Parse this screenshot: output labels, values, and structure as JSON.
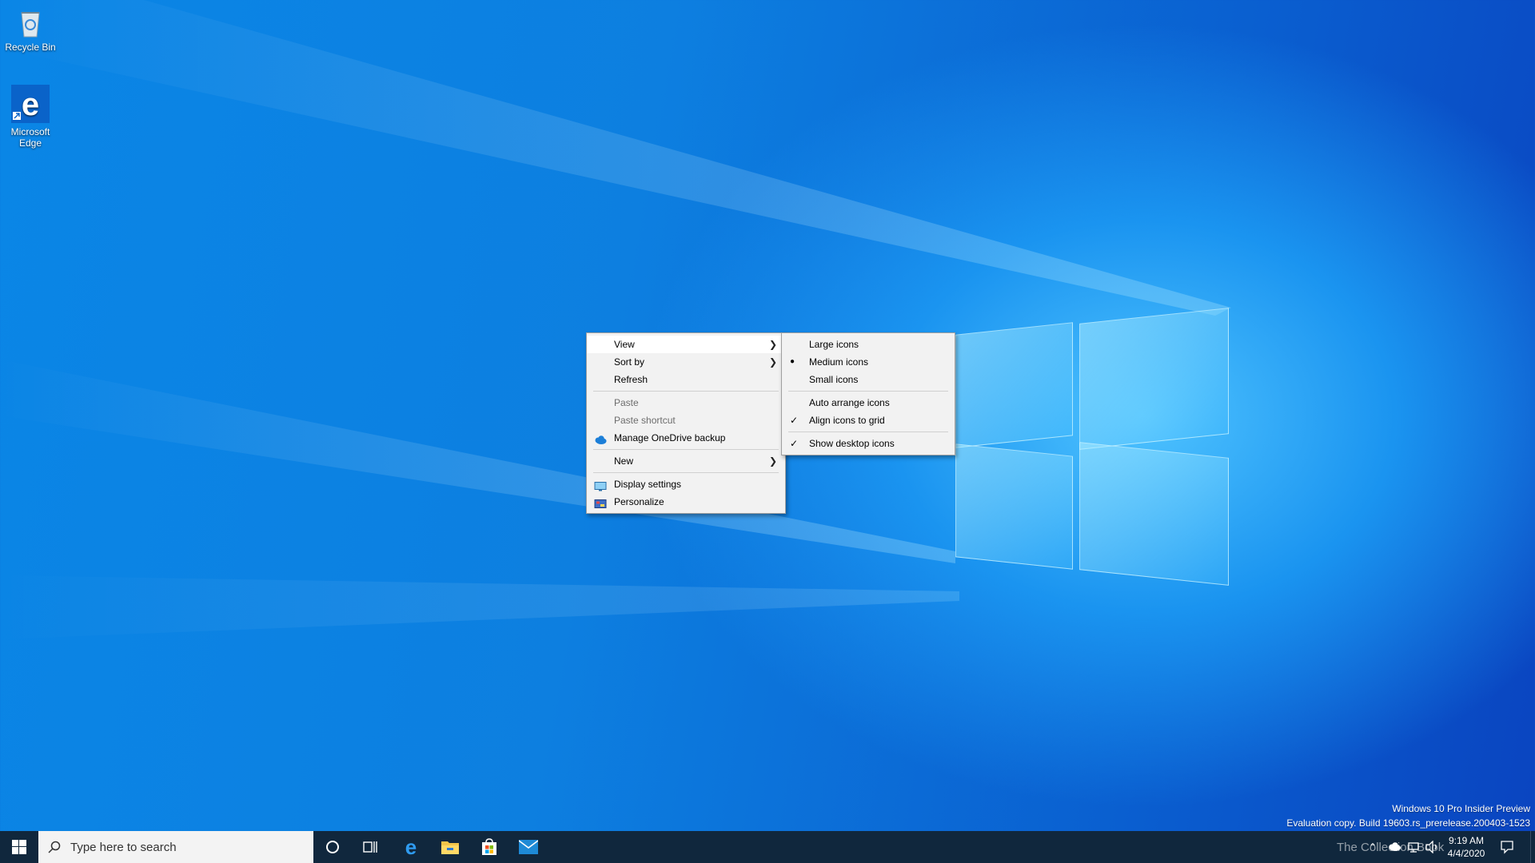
{
  "desktop": {
    "icons": [
      {
        "label": "Recycle Bin"
      },
      {
        "label": "Microsoft Edge"
      }
    ]
  },
  "context_menu": {
    "items": [
      {
        "label": "View",
        "submenu": true
      },
      {
        "label": "Sort by",
        "submenu": true
      },
      {
        "label": "Refresh"
      },
      {
        "label": "Paste",
        "disabled": true
      },
      {
        "label": "Paste shortcut",
        "disabled": true
      },
      {
        "label": "Manage OneDrive backup",
        "icon": "onedrive-icon"
      },
      {
        "label": "New",
        "submenu": true
      },
      {
        "label": "Display settings",
        "icon": "display-icon"
      },
      {
        "label": "Personalize",
        "icon": "personalize-icon"
      }
    ]
  },
  "view_submenu": {
    "items": [
      {
        "label": "Large icons"
      },
      {
        "label": "Medium icons",
        "selected": true
      },
      {
        "label": "Small icons"
      },
      {
        "label": "Auto arrange icons"
      },
      {
        "label": "Align icons to grid",
        "checked": true
      },
      {
        "label": "Show desktop icons",
        "checked": true
      }
    ]
  },
  "watermark": {
    "line1": "Windows 10 Pro Insider Preview",
    "line2": "Evaluation copy. Build 19603.rs_prerelease.200403-1523"
  },
  "taskbar": {
    "search_placeholder": "Type here to search",
    "time": "9:19 AM",
    "date": "4/4/2020",
    "overlay_text": "The Collection Book"
  },
  "colors": {
    "taskbar": "#10273d",
    "menu_bg": "#f2f2f2",
    "accent": "#0078d7"
  }
}
